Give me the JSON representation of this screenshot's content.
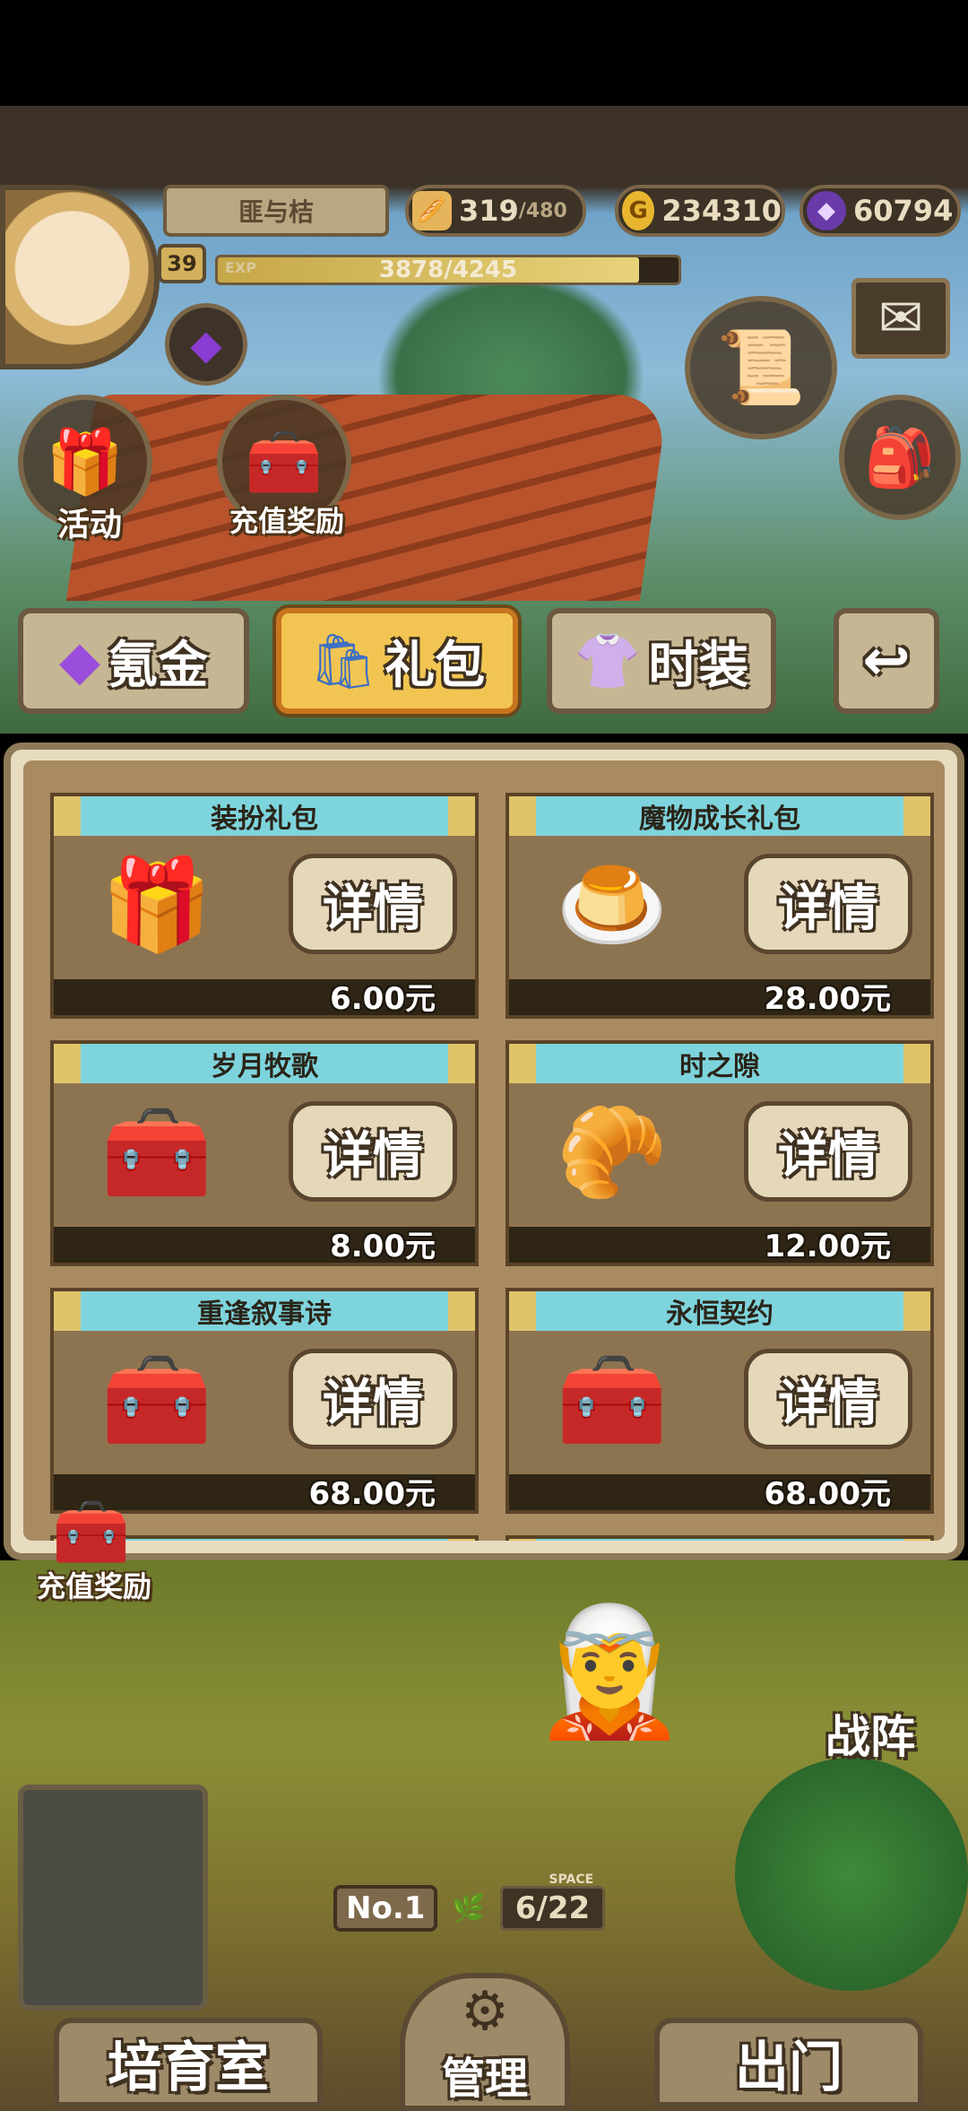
{
  "header": {
    "player_name": "匪与桔",
    "level": "39",
    "exp_label": "EXP",
    "exp_text": "3878/4245",
    "exp_progress": 0.914,
    "stamina": "319",
    "stamina_max": "/480",
    "gold": "234310",
    "gems": "60794"
  },
  "shortcuts": {
    "activity_label": "活动",
    "recharge_reward_label": "充值奖励"
  },
  "tabs": [
    {
      "icon": "gem-icon",
      "label": "氪金",
      "active": false
    },
    {
      "icon": "gift-bag-icon",
      "label": "礼包",
      "active": true
    },
    {
      "icon": "outfit-icon",
      "label": "时装",
      "active": false
    }
  ],
  "packs": [
    {
      "name": "装扮礼包",
      "detail_label": "详情",
      "price": "6.00元"
    },
    {
      "name": "魔物成长礼包",
      "detail_label": "详情",
      "price": "28.00元"
    },
    {
      "name": "岁月牧歌",
      "detail_label": "详情",
      "price": "8.00元"
    },
    {
      "name": "时之隙",
      "detail_label": "详情",
      "price": "12.00元"
    },
    {
      "name": "重逢叙事诗",
      "detail_label": "详情",
      "price": "68.00元"
    },
    {
      "name": "永恒契约",
      "detail_label": "详情",
      "price": "68.00元"
    }
  ],
  "floating": {
    "recharge_reward_label": "充值奖励"
  },
  "bottom": {
    "formation_label": "战阵",
    "nest_no_label": "No.",
    "nest_no": "1",
    "space_label": "SPACE",
    "space_value": "6/22",
    "nursery_label": "培育室",
    "manage_label": "管理",
    "depart_label": "出门"
  },
  "colors": {
    "tab_active": "#f2c552",
    "card_header": "#7ed4dd",
    "panel_border": "#8e7a58"
  }
}
